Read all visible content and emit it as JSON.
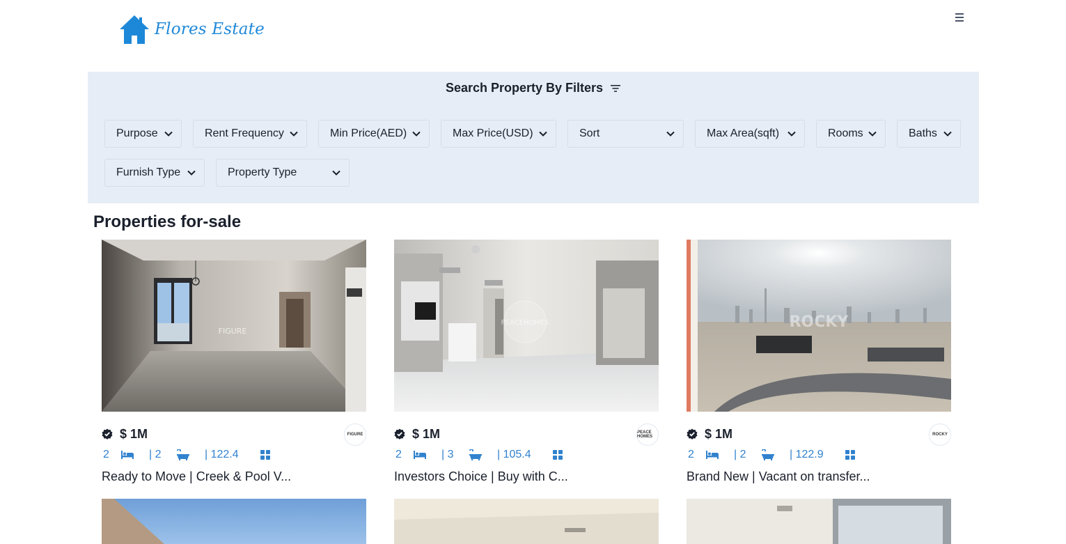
{
  "brand": {
    "name": "Flores Estate",
    "color": "#1e88d8"
  },
  "header": {
    "menu_icon": "hamburger-menu-icon"
  },
  "filters": {
    "title": "Search Property By Filters",
    "title_icon": "filter-lines-icon",
    "background": "#e7edf6",
    "selects": [
      {
        "label": "Purpose"
      },
      {
        "label": "Rent Frequency"
      },
      {
        "label": "Min Price(AED)"
      },
      {
        "label": "Max Price(USD)"
      },
      {
        "label": "Sort"
      },
      {
        "label": "Max Area(sqft)"
      },
      {
        "label": "Rooms"
      },
      {
        "label": "Baths"
      },
      {
        "label": "Furnish Type"
      },
      {
        "label": "Property Type"
      }
    ]
  },
  "listing": {
    "title": "Properties for-sale",
    "cards": [
      {
        "price": "$ 1M",
        "rooms": "2",
        "baths": "| 2",
        "area": "| 122.4",
        "title": "Ready to Move | Creek & Pool V...",
        "agency_label": "FIGURE"
      },
      {
        "price": "$ 1M",
        "rooms": "2",
        "baths": "| 3",
        "area": "| 105.4",
        "title": "Investors Choice | Buy with C...",
        "agency_label": "PEACE HOMES"
      },
      {
        "price": "$ 1M",
        "rooms": "2",
        "baths": "| 2",
        "area": "| 122.9",
        "title": "Brand New | Vacant on transfer...",
        "agency_label": "ROCKY"
      }
    ]
  },
  "colors": {
    "accent": "#3182ce",
    "text": "#1a202c"
  }
}
